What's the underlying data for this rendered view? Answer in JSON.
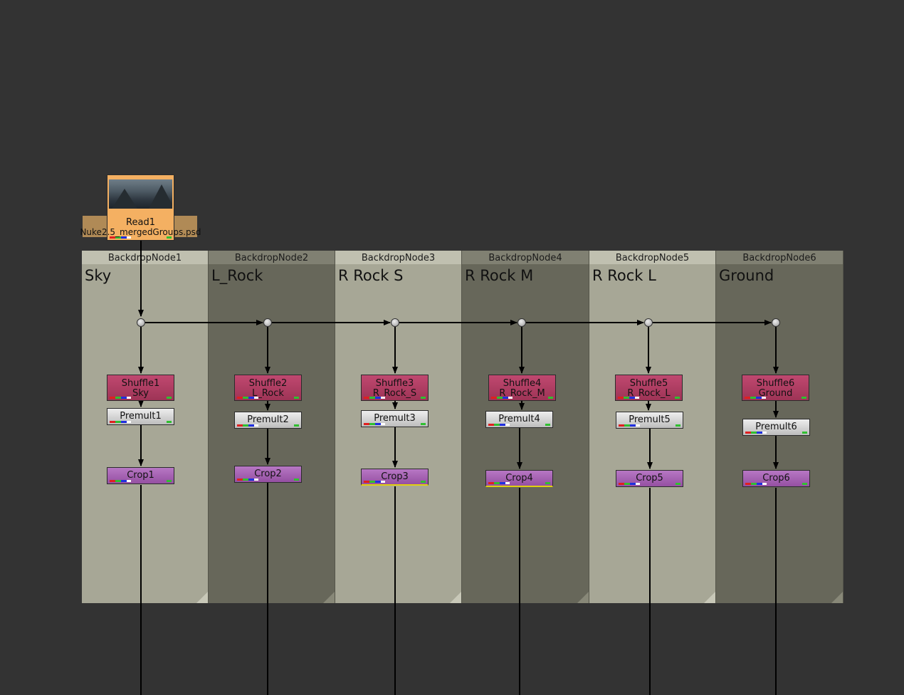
{
  "read": {
    "name": "Read1",
    "file": "Nuke2.5_mergedGroups.psd"
  },
  "backdrops": [
    {
      "header": "BackdropNode1",
      "label": "Sky"
    },
    {
      "header": "BackdropNode2",
      "label": "L_Rock"
    },
    {
      "header": "BackdropNode3",
      "label": "R Rock S"
    },
    {
      "header": "BackdropNode4",
      "label": "R Rock M"
    },
    {
      "header": "BackdropNode5",
      "label": "R Rock L"
    },
    {
      "header": "BackdropNode6",
      "label": "Ground"
    }
  ],
  "columns": [
    {
      "shuffle": "Shuffle1",
      "layer": "Sky",
      "premult": "Premult1",
      "crop": "Crop1"
    },
    {
      "shuffle": "Shuffle2",
      "layer": "L_Rock",
      "premult": "Premult2",
      "crop": "Crop2"
    },
    {
      "shuffle": "Shuffle3",
      "layer": "R_Rock_S",
      "premult": "Premult3",
      "crop": "Crop3"
    },
    {
      "shuffle": "Shuffle4",
      "layer": "R_Rock_M",
      "premult": "Premult4",
      "crop": "Crop4"
    },
    {
      "shuffle": "Shuffle5",
      "layer": "R_Rock_L",
      "premult": "Premult5",
      "crop": "Crop5"
    },
    {
      "shuffle": "Shuffle6",
      "layer": "Ground",
      "premult": "Premult6",
      "crop": "Crop6"
    }
  ],
  "colors": {
    "canvas": "#333333",
    "backdrop_light": "#a7a796",
    "backdrop_dark": "#67675a",
    "read_node": "#f4b062",
    "shuffle_node": "#b03c62",
    "premult_node": "#d8d8d8",
    "crop_node": "#a563b2",
    "edge": "#000000"
  }
}
